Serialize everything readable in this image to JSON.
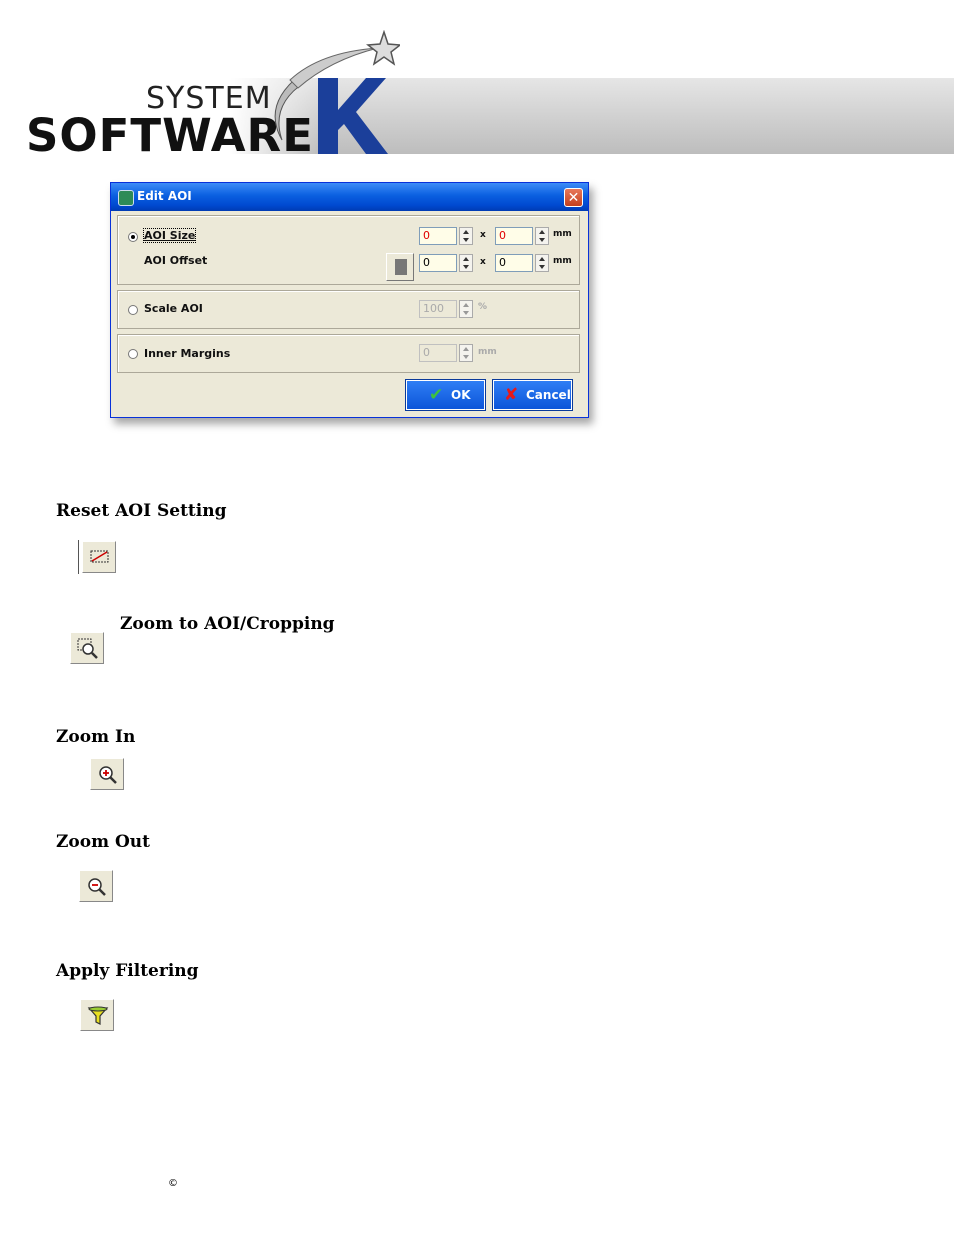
{
  "header": {
    "logo_line1": "SYSTEM",
    "logo_line2": "SOFTWARE",
    "logo_letter": "K"
  },
  "dialog": {
    "title": "Edit AOI",
    "close_label": "✕",
    "aoi_size": {
      "label": "AOI Size",
      "selected": true,
      "width": "0",
      "height": "0",
      "unit": "mm",
      "separator": "x"
    },
    "aoi_offset": {
      "label": "AOI Offset",
      "x": "0",
      "y": "0",
      "unit": "mm",
      "separator": "x"
    },
    "scale_aoi": {
      "label": "Scale AOI",
      "value": "100",
      "unit": "%",
      "enabled": false
    },
    "inner_margins": {
      "label": "Inner Margins",
      "value": "0",
      "unit": "mm",
      "enabled": false
    },
    "ok_label": "OK",
    "cancel_label": "Cancel",
    "ok_icon": "checkmark-icon",
    "cancel_icon": "x-icon"
  },
  "sections": [
    {
      "heading": "Reset AOI Setting",
      "icon": "reset-aoi-icon"
    },
    {
      "heading": "Zoom to AOI/Cropping",
      "icon": "zoom-to-aoi-icon"
    },
    {
      "heading": "Zoom In",
      "icon": "zoom-in-icon"
    },
    {
      "heading": "Zoom Out",
      "icon": "zoom-out-icon"
    },
    {
      "heading": "Apply Filtering",
      "icon": "filter-icon"
    }
  ],
  "footer": {
    "copyright": "©"
  }
}
